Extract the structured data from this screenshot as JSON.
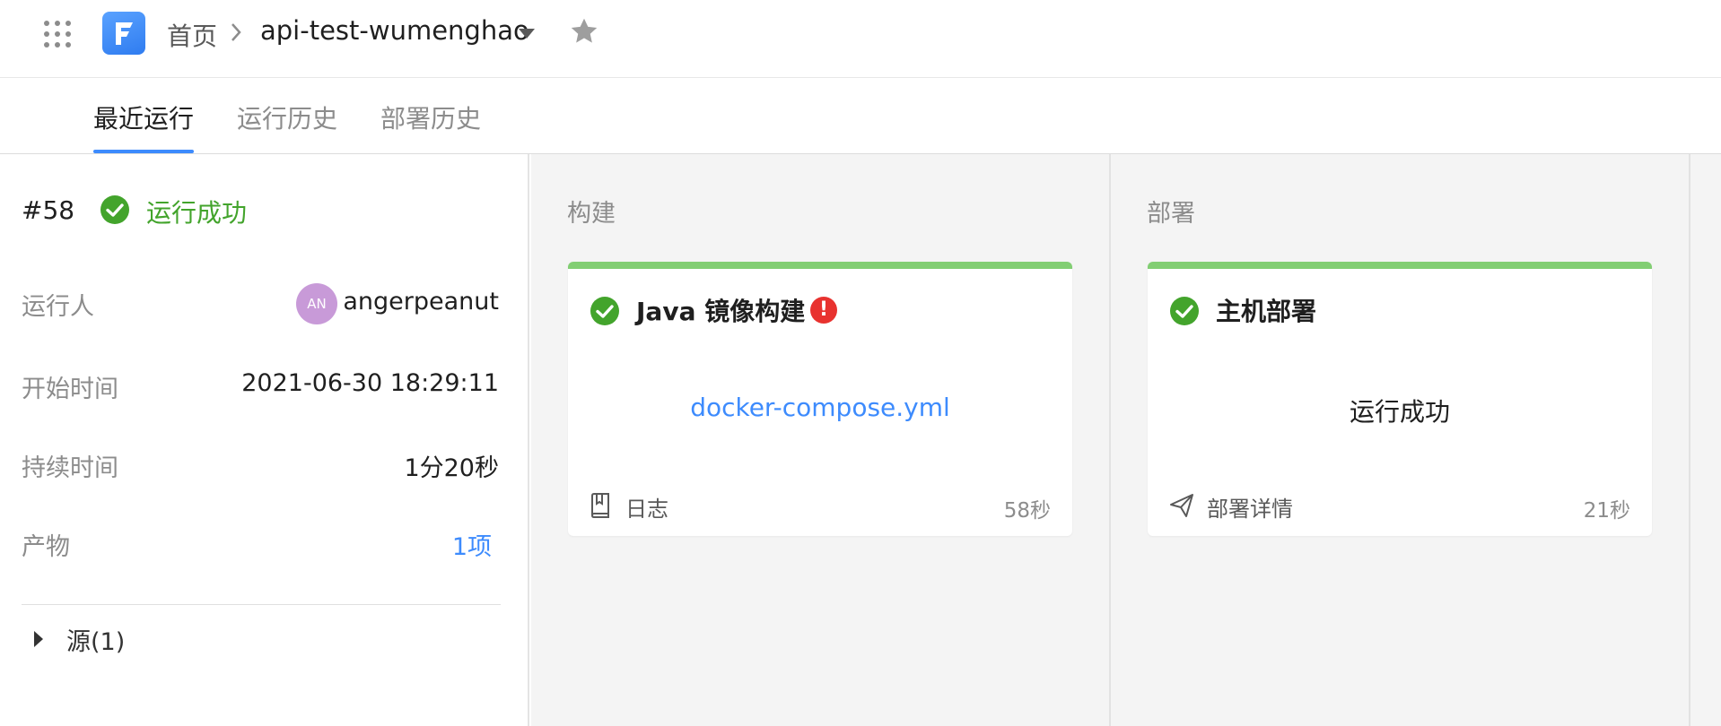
{
  "header": {
    "breadcrumb_home": "首页",
    "project_name": "api-test-wumenghao",
    "icons": {
      "apps": "grid-dots-icon",
      "logo": "app-logo-f",
      "separator": "chevron-right-icon",
      "dropdown": "caret-down-icon",
      "favorite": "star-icon"
    }
  },
  "tabs": [
    {
      "label": "最近运行",
      "active": true
    },
    {
      "label": "运行历史",
      "active": false
    },
    {
      "label": "部署历史",
      "active": false
    }
  ],
  "run": {
    "number": "#58",
    "status": "运行成功",
    "fields": {
      "runner_label": "运行人",
      "runner_avatar": "AN",
      "runner_name": "angerpeanut",
      "start_label": "开始时间",
      "start_value": "2021-06-30 18:29:11",
      "duration_label": "持续时间",
      "duration_value": "1分20秒",
      "artifacts_label": "产物",
      "artifacts_value": "1项"
    },
    "source_label": "源(1)"
  },
  "stages": [
    {
      "title": "构建",
      "card": {
        "name": "Java 镜像构建",
        "warning": "!",
        "center_text": "docker-compose.yml",
        "footer_label": "日志",
        "duration": "58秒"
      }
    },
    {
      "title": "部署",
      "card": {
        "name": "主机部署",
        "center_text": "运行成功",
        "footer_label": "部署详情",
        "duration": "21秒"
      }
    }
  ],
  "colors": {
    "success": "#43a42c",
    "link": "#3d8bfd",
    "card_top_bar": "#82ce73",
    "warning": "#e8322f"
  }
}
